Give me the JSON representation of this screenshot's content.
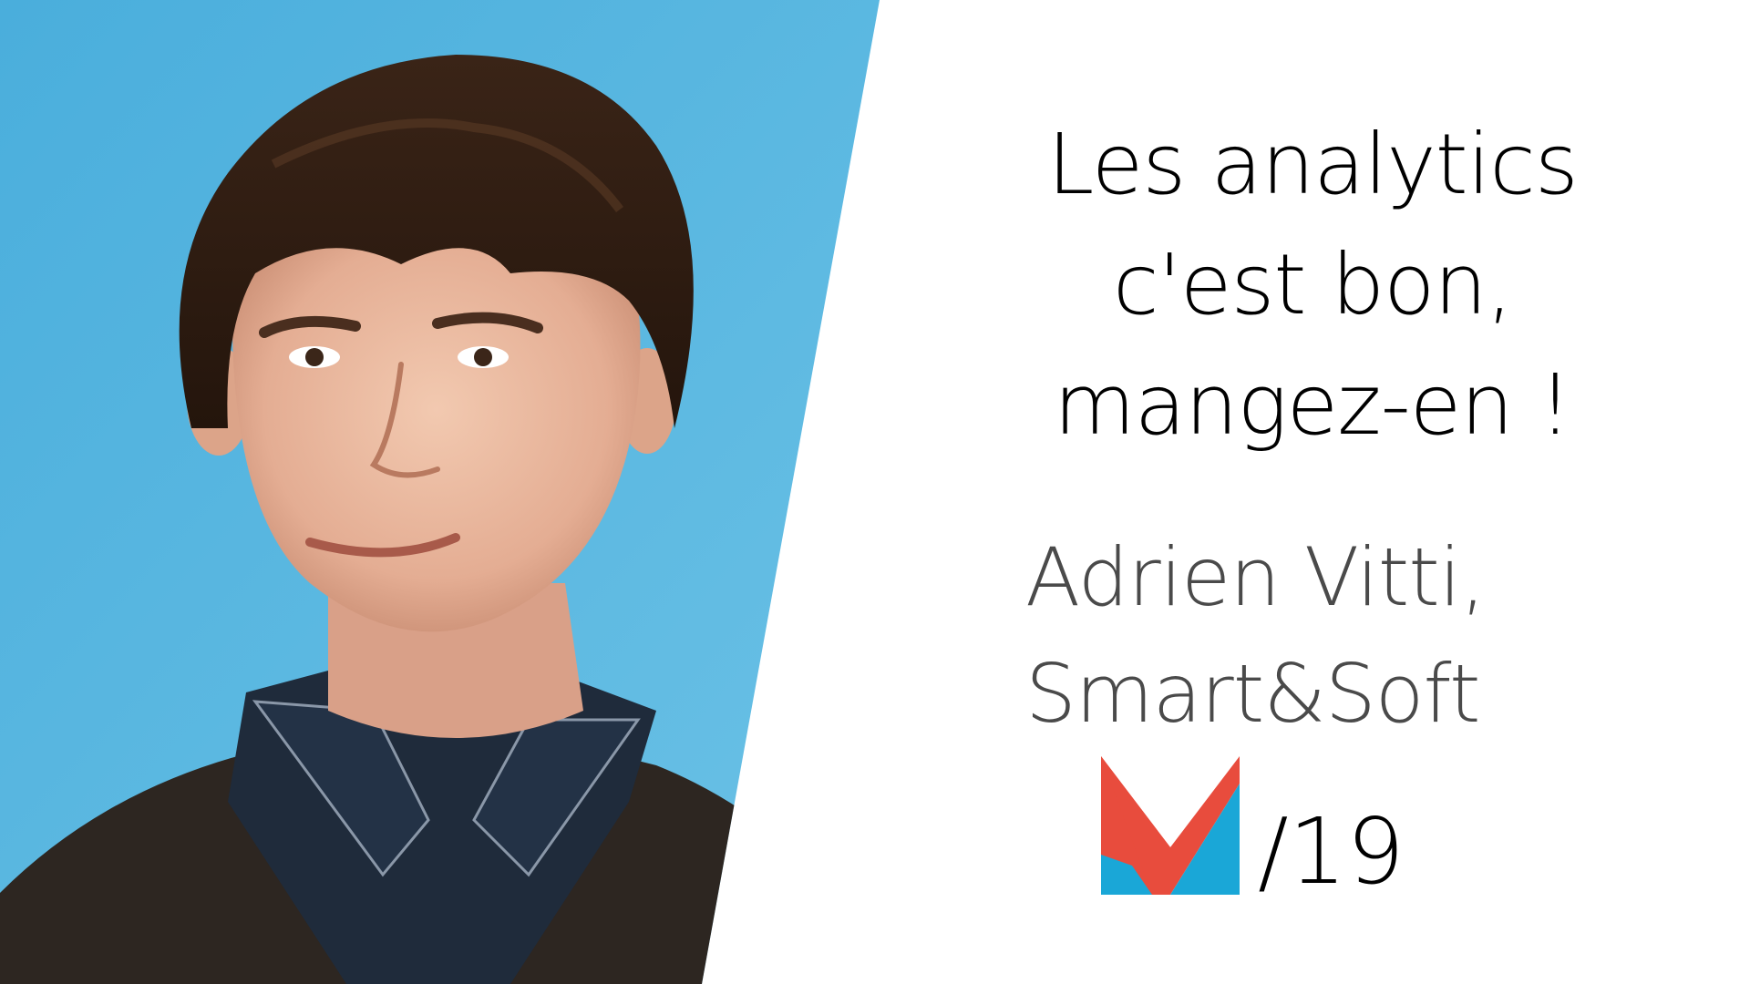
{
  "talk": {
    "title_lines": [
      "Les analytics",
      "c'est bon,",
      "mangez-en !"
    ]
  },
  "speaker": {
    "name_line": "Adrien Vitti,",
    "company_line": "Smart&Soft"
  },
  "event": {
    "edition": "/19",
    "logo_icon": "m-logo-icon"
  },
  "colors": {
    "photo_background": "#56b4dd",
    "logo_red": "#e84c3d",
    "logo_blue": "#1aa7d7",
    "title_text": "#000000",
    "speaker_text": "#4a4a4a"
  }
}
